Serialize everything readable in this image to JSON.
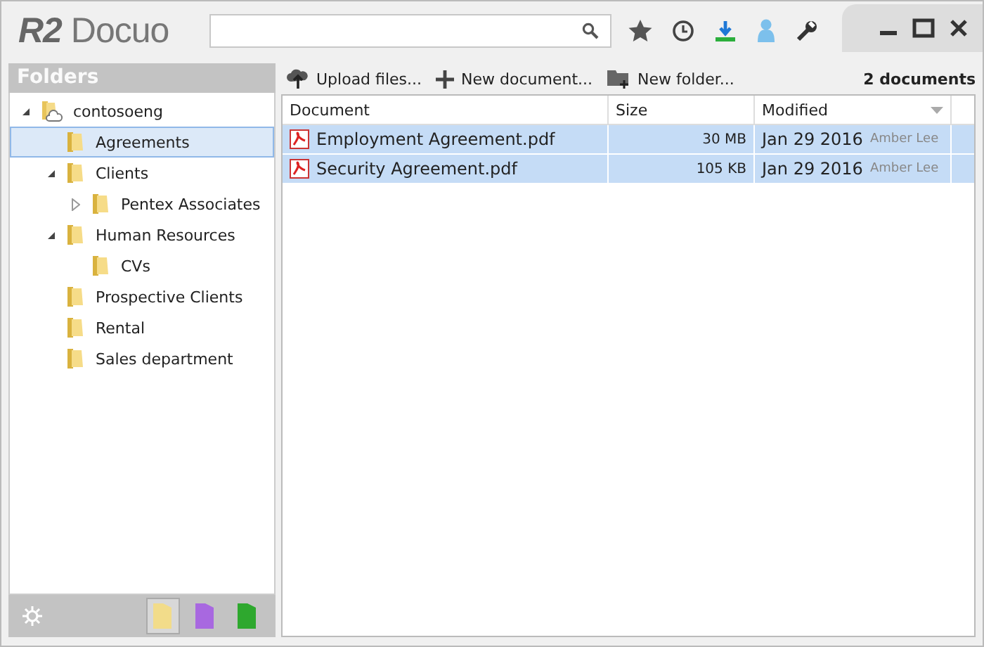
{
  "app": {
    "logo_mark": "R2",
    "logo_text": "Docuo"
  },
  "sidebar": {
    "title": "Folders",
    "tree": [
      {
        "label": "contosoeng",
        "kind": "root",
        "expanded": true,
        "selected": false,
        "children": [
          {
            "label": "Agreements",
            "kind": "folder",
            "selected": true
          },
          {
            "label": "Clients",
            "kind": "folder",
            "expanded": true,
            "selected": false,
            "children": [
              {
                "label": "Pentex Associates",
                "kind": "folder",
                "expanded": false,
                "selected": false
              }
            ]
          },
          {
            "label": "Human Resources",
            "kind": "folder",
            "expanded": true,
            "selected": false,
            "children": [
              {
                "label": "CVs",
                "kind": "folder",
                "selected": false
              }
            ]
          },
          {
            "label": "Prospective Clients",
            "kind": "folder",
            "selected": false
          },
          {
            "label": "Rental",
            "kind": "folder",
            "selected": false
          },
          {
            "label": "Sales department",
            "kind": "folder",
            "selected": false
          }
        ]
      }
    ],
    "views": [
      {
        "color": "#f2dc8a",
        "selected": true
      },
      {
        "color": "#a868e0",
        "selected": false
      },
      {
        "color": "#2ea82e",
        "selected": false
      }
    ]
  },
  "toolbar": {
    "actions": [
      {
        "kind": "upload",
        "label": "Upload files..."
      },
      {
        "kind": "new-document",
        "label": "New document..."
      },
      {
        "kind": "new-folder",
        "label": "New folder..."
      }
    ],
    "count": "2 documents"
  },
  "table": {
    "columns": [
      "Document",
      "Size",
      "Modified"
    ],
    "rows": [
      {
        "name": "Employment Agreement.pdf",
        "size": "30 MB",
        "date": "Jan 29 2016",
        "author": "Amber Lee",
        "selected": true
      },
      {
        "name": "Security Agreement.pdf",
        "size": "105 KB",
        "date": "Jan 29 2016",
        "author": "Amber Lee",
        "selected": true
      }
    ]
  }
}
